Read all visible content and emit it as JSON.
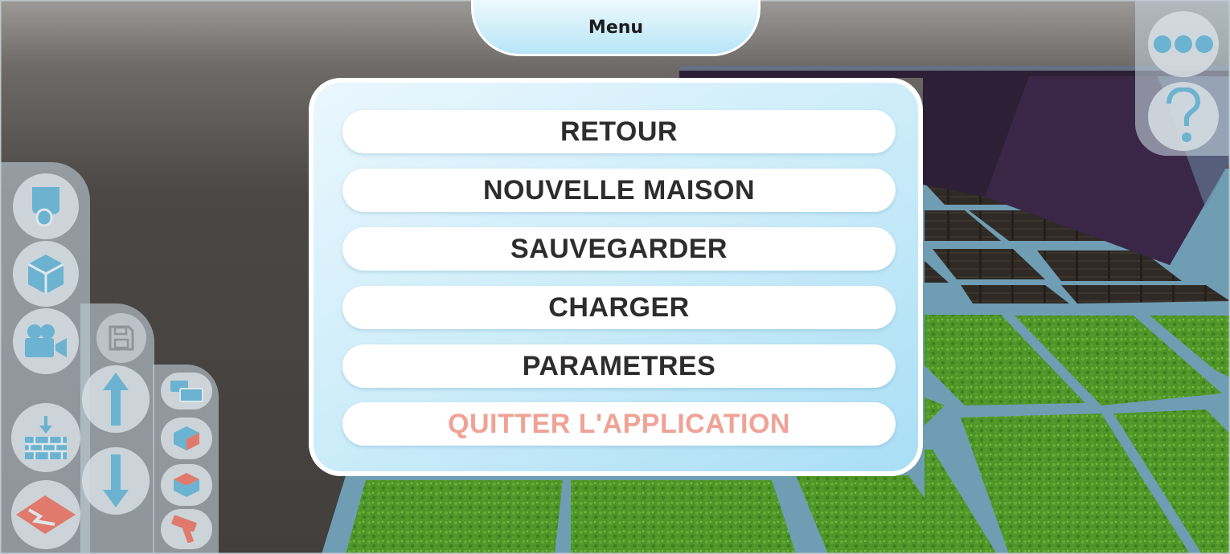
{
  "menu": {
    "title": "Menu",
    "items": [
      {
        "label": "RETOUR"
      },
      {
        "label": "NOUVELLE MAISON"
      },
      {
        "label": "SAUVEGARDER"
      },
      {
        "label": "CHARGER"
      },
      {
        "label": "PARAMETRES"
      },
      {
        "label": "QUITTER L'APPLICATION"
      }
    ]
  },
  "colors": {
    "menu_bg": "#c9ebf9",
    "button_bg": "#ffffff",
    "button_text": "#2d2d2d",
    "quit_text": "#f0a296",
    "toolbar_icon": "#6bb3d0",
    "toolbar_accent": "#e07a6c"
  },
  "toolbar_icons": {
    "left": [
      "hand-icon",
      "cube-icon",
      "camera-icon",
      "save-icon",
      "arrow-up-icon",
      "arrow-down-icon",
      "place-wall-icon",
      "floor-cut-icon"
    ],
    "tiles": [
      "blocks-icon",
      "floor-tile-icon",
      "wall-tile-icon",
      "hammer-icon"
    ],
    "top_right": [
      "more-options-icon",
      "help-icon"
    ]
  }
}
